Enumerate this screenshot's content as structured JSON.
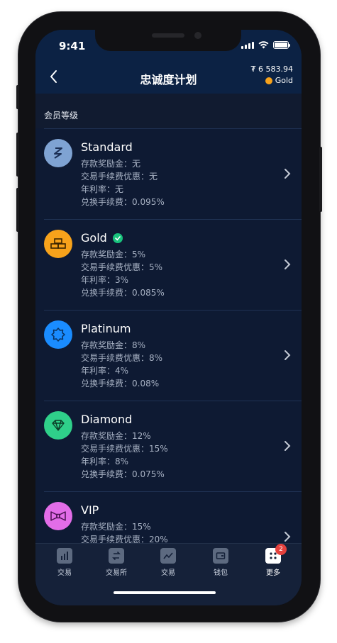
{
  "status": {
    "time": "9:41"
  },
  "nav": {
    "title": "忠诚度计划",
    "balance": "₮ 6 583.94",
    "tier": "Gold",
    "tier_color": "#f7a21b"
  },
  "section": {
    "title": "会员等级"
  },
  "tiers": [
    {
      "name": "Standard",
      "color": "#7fa3d3",
      "icon": "standard-icon",
      "current": false,
      "details": [
        "存款奖励金：无",
        "交易手续费优惠：无",
        "年利率：无",
        "兑换手续费：0.095%"
      ]
    },
    {
      "name": "Gold",
      "color": "#f7a21b",
      "icon": "gold-bars-icon",
      "current": true,
      "details": [
        "存款奖励金：5%",
        "交易手续费优惠：5%",
        "年利率：3%",
        "兑换手续费：0.085%"
      ]
    },
    {
      "name": "Platinum",
      "color": "#1a8cff",
      "icon": "badge-icon",
      "current": false,
      "details": [
        "存款奖励金：8%",
        "交易手续费优惠：8%",
        "年利率：4%",
        "兑换手续费：0.08%"
      ]
    },
    {
      "name": "Diamond",
      "color": "#2fd08a",
      "icon": "diamond-icon",
      "current": false,
      "details": [
        "存款奖励金：12%",
        "交易手续费优惠：15%",
        "年利率：8%",
        "兑换手续费：0.075%"
      ]
    },
    {
      "name": "VIP",
      "color": "#e26de8",
      "icon": "bow-tie-icon",
      "current": false,
      "details": [
        "存款奖励金：15%",
        "交易手续费优惠：20%"
      ]
    }
  ],
  "tabs": [
    {
      "label": "交易",
      "icon": "chart-icon"
    },
    {
      "label": "交易所",
      "icon": "exchange-icon"
    },
    {
      "label": "交易",
      "icon": "trend-icon"
    },
    {
      "label": "钱包",
      "icon": "wallet-icon"
    },
    {
      "label": "更多",
      "icon": "dice-icon",
      "badge": "2",
      "active": true
    }
  ]
}
